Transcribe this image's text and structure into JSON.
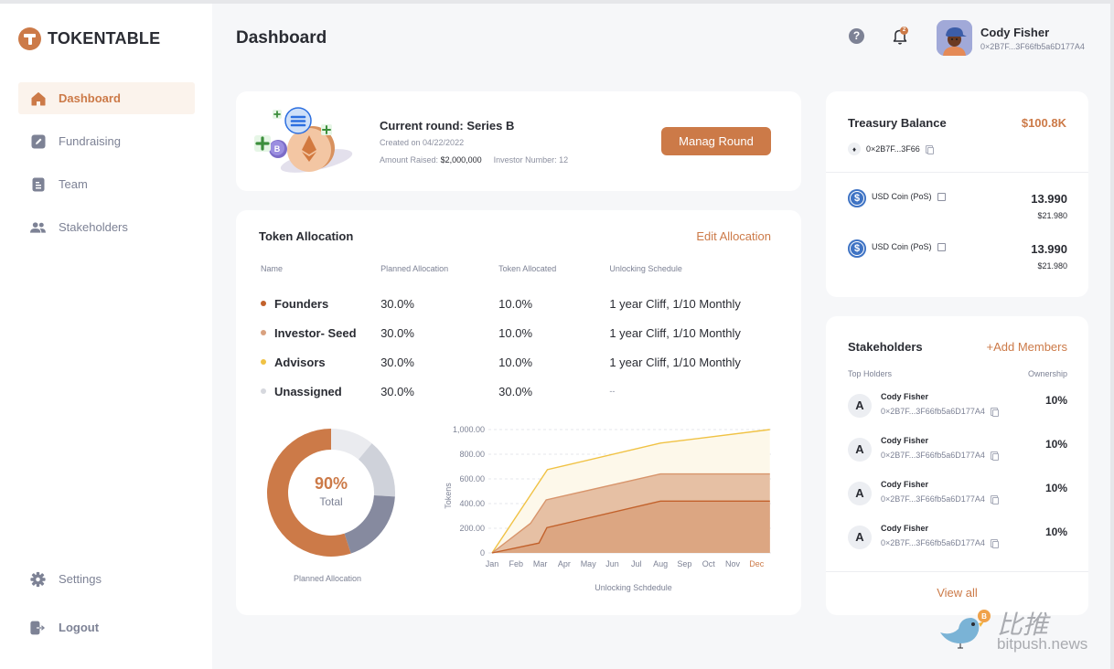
{
  "app": {
    "name": "TOKENTABLE",
    "brand_color": "#cc7a48"
  },
  "sidebar": {
    "items": [
      {
        "label": "Dashboard",
        "icon": "home-icon",
        "active": true
      },
      {
        "label": "Fundraising",
        "icon": "edit-icon",
        "active": false
      },
      {
        "label": "Team",
        "icon": "document-icon",
        "active": false
      },
      {
        "label": "Stakeholders",
        "icon": "users-icon",
        "active": false
      }
    ],
    "bottom_items": [
      {
        "label": "Settings",
        "icon": "gear-icon"
      },
      {
        "label": "Logout",
        "icon": "logout-icon"
      }
    ]
  },
  "header": {
    "title": "Dashboard",
    "notification_count": "2",
    "user": {
      "name": "Cody Fisher",
      "address": "0×2B7F...3F66fb5a6D177A4"
    }
  },
  "round": {
    "title": "Current round: Series B",
    "created": "Created on 04/22/2022",
    "amount_label": "Amount Raised:",
    "amount_value": "$2,000,000",
    "investor_label": "Investor Number:",
    "investor_value": "12",
    "button_label": "Manag Round"
  },
  "allocation": {
    "title": "Token Allocation",
    "edit_label": "Edit Allocation",
    "columns": [
      "Name",
      "Planned Allocation",
      "Token Allocated",
      "Unlocking Schedule"
    ],
    "rows": [
      {
        "name": "Founders",
        "color": "#c2612b",
        "planned": "30.0%",
        "allocated": "10.0%",
        "schedule": "1 year Cliff, 1/10 Monthly"
      },
      {
        "name": "Investor- Seed",
        "color": "#d9a17f",
        "planned": "30.0%",
        "allocated": "10.0%",
        "schedule": "1 year Cliff, 1/10 Monthly"
      },
      {
        "name": "Advisors",
        "color": "#f0c244",
        "planned": "30.0%",
        "allocated": "10.0%",
        "schedule": "1 year Cliff, 1/10 Monthly"
      },
      {
        "name": "Unassigned",
        "color": "#d6d8de",
        "planned": "30.0%",
        "allocated": "30.0%",
        "schedule": "--"
      }
    ],
    "donut": {
      "center_value": "90%",
      "center_label": "Total",
      "caption": "Planned Allocation"
    }
  },
  "chart_data": [
    {
      "type": "pie",
      "title": "Planned Allocation",
      "center_text": "90% Total",
      "slices": [
        {
          "name": "segment-1",
          "value": 11,
          "color": "#eaebef"
        },
        {
          "name": "segment-2",
          "value": 15,
          "color": "#cfd2da"
        },
        {
          "name": "segment-3",
          "value": 19,
          "color": "#868a9f"
        },
        {
          "name": "segment-4",
          "value": 55,
          "color": "#cc7a48"
        }
      ]
    },
    {
      "type": "area",
      "title": "",
      "xlabel": "Unlocking Schdedule",
      "ylabel": "Tokens",
      "categories": [
        "Jan",
        "Feb",
        "Mar",
        "Apr",
        "May",
        "Jun",
        "Jul",
        "Aug",
        "Sep",
        "Oct",
        "Nov",
        "Dec"
      ],
      "highlight_category": "Dec",
      "ylim": [
        0,
        1000
      ],
      "yticks": [
        "0",
        "200.00",
        "400.00",
        "600.00",
        "800.00",
        "1,000.00"
      ],
      "ytick_values": [
        0,
        200,
        400,
        600,
        800,
        1000
      ],
      "grid": true,
      "x_domain": [
        0,
        11.55
      ],
      "series": [
        {
          "name": "Advisors",
          "line": "#f0c244",
          "fill": "#fdf8ea",
          "points": [
            [
              0,
              0
            ],
            [
              2.3,
              675
            ],
            [
              7,
              890
            ],
            [
              11.55,
              1000
            ]
          ]
        },
        {
          "name": "Investor- Seed",
          "line": "#d8956c",
          "fill": "#e6c0a4",
          "points": [
            [
              0,
              0
            ],
            [
              1.6,
              240
            ],
            [
              2.25,
              430
            ],
            [
              7,
              640
            ],
            [
              11.55,
              640
            ]
          ]
        },
        {
          "name": "Founders",
          "line": "#c2612b",
          "fill": "#dca682",
          "points": [
            [
              0,
              0
            ],
            [
              1.95,
              80
            ],
            [
              2.28,
              205
            ],
            [
              7,
              420
            ],
            [
              11.55,
              420
            ]
          ]
        }
      ]
    }
  ],
  "treasury": {
    "title": "Treasury Balance",
    "value": "$100.8K",
    "address": "0×2B7F...3F66",
    "coins": [
      {
        "name": "USD Coin (PoS)",
        "amount": "13.990",
        "usd": "$21.980"
      },
      {
        "name": "USD Coin (PoS)",
        "amount": "13.990",
        "usd": "$21.980"
      }
    ]
  },
  "stakeholders": {
    "title": "Stakeholders",
    "add_label": "+Add Members",
    "col_left": "Top Holders",
    "col_right": "Ownership",
    "holders": [
      {
        "initial": "A",
        "name": "Cody Fisher",
        "address": "0×2B7F...3F66fb5a6D177A4",
        "ownership": "10%"
      },
      {
        "initial": "A",
        "name": "Cody Fisher",
        "address": "0×2B7F...3F66fb5a6D177A4",
        "ownership": "10%"
      },
      {
        "initial": "A",
        "name": "Cody Fisher",
        "address": "0×2B7F...3F66fb5a6D177A4",
        "ownership": "10%"
      },
      {
        "initial": "A",
        "name": "Cody Fisher",
        "address": "0×2B7F...3F66fb5a6D177A4",
        "ownership": "10%"
      }
    ],
    "view_all": "View all"
  },
  "watermark": {
    "cn": "比推",
    "en": "bitpush.news"
  }
}
